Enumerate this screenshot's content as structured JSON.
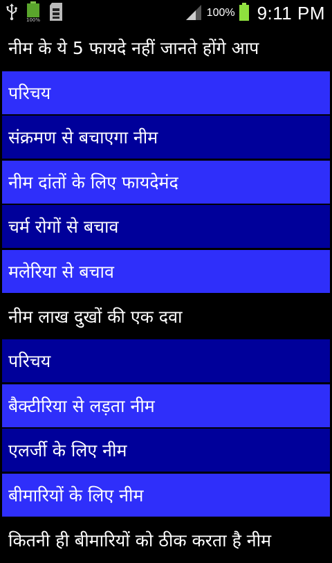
{
  "status_bar": {
    "battery_percent": "100%",
    "time": "9:11 PM",
    "icons": [
      "usb-icon",
      "battery-full-icon",
      "sd-card-icon",
      "signal-icon",
      "battery-icon"
    ]
  },
  "colors": {
    "header_bg": "#000000",
    "item_light": "#2f2ffa",
    "item_dark": "#00009a",
    "text": "#ffffff"
  },
  "list": [
    {
      "label": "नीम के ये 5 फायदे नहीं जानते होंगे आप",
      "kind": "header"
    },
    {
      "label": "परिचय",
      "kind": "light"
    },
    {
      "label": "संक्रमण से बचाएगा नीम",
      "kind": "dark"
    },
    {
      "label": "नीम दांतों के लिए फायदेमंद",
      "kind": "light"
    },
    {
      "label": "चर्म रोगों से बचाव",
      "kind": "dark"
    },
    {
      "label": "मलेरिया से बचाव",
      "kind": "light"
    },
    {
      "label": "नीम लाख दुखों की एक दवा",
      "kind": "header"
    },
    {
      "label": "परिचय",
      "kind": "dark"
    },
    {
      "label": "बैक्टीरिया से लड़ता नीम",
      "kind": "light"
    },
    {
      "label": "एलर्जी के लिए नीम",
      "kind": "dark"
    },
    {
      "label": "बीमारियों के लिए नीम",
      "kind": "light"
    },
    {
      "label": "कितनी ही बीमारियों को ठीक करता है नीम",
      "kind": "header"
    }
  ]
}
